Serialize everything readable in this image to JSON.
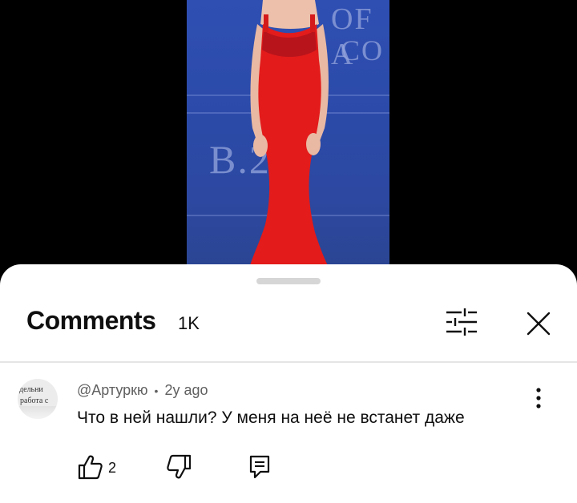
{
  "video": {
    "bg_text_top": "OF A",
    "bg_text_mid": "CO",
    "bg_text_brand": "B.2 1",
    "dress_color": "#e31b1b",
    "backdrop_color": "#2e4cab"
  },
  "comments_panel": {
    "title": "Comments",
    "count": "1K",
    "filter_icon": "sliders-icon",
    "close_icon": "close-icon"
  },
  "comment": {
    "avatar_line1": "дельни",
    "avatar_line2": "работа с",
    "author": "@Артуркю",
    "separator": "•",
    "time": "2y ago",
    "text": "Что в ней нашли? У меня на неё не встанет даже",
    "like_count": "2",
    "icons": [
      "thumbs-up-icon",
      "thumbs-down-icon",
      "reply-icon",
      "more-vertical-icon"
    ]
  }
}
